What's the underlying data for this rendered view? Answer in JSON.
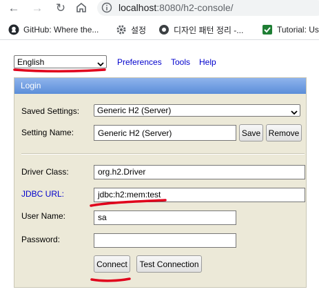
{
  "browser": {
    "url_host": "localhost",
    "url_rest": ":8080/h2-console/",
    "bookmarks": [
      {
        "label": "GitHub: Where the..."
      },
      {
        "label": "설정"
      },
      {
        "label": "디자인 패턴 정리 -..."
      },
      {
        "label": "Tutorial: Us"
      }
    ]
  },
  "topbar": {
    "language": "English",
    "links": [
      "Preferences",
      "Tools",
      "Help"
    ]
  },
  "login": {
    "title": "Login",
    "saved_settings_label": "Saved Settings:",
    "saved_settings_value": "Generic H2 (Server)",
    "setting_name_label": "Setting Name:",
    "setting_name_value": "Generic H2 (Server)",
    "save_label": "Save",
    "remove_label": "Remove",
    "driver_class_label": "Driver Class:",
    "driver_class_value": "org.h2.Driver",
    "jdbc_url_label": "JDBC URL:",
    "jdbc_url_value": "jdbc:h2:mem:test",
    "user_name_label": "User Name:",
    "user_name_value": "sa",
    "password_label": "Password:",
    "password_value": "",
    "connect_label": "Connect",
    "test_connection_label": "Test Connection"
  },
  "colors": {
    "annotation": "#e0001b",
    "panel_bg": "#ece9d8",
    "header": "#6f9ce0",
    "link": "#0000cc"
  }
}
